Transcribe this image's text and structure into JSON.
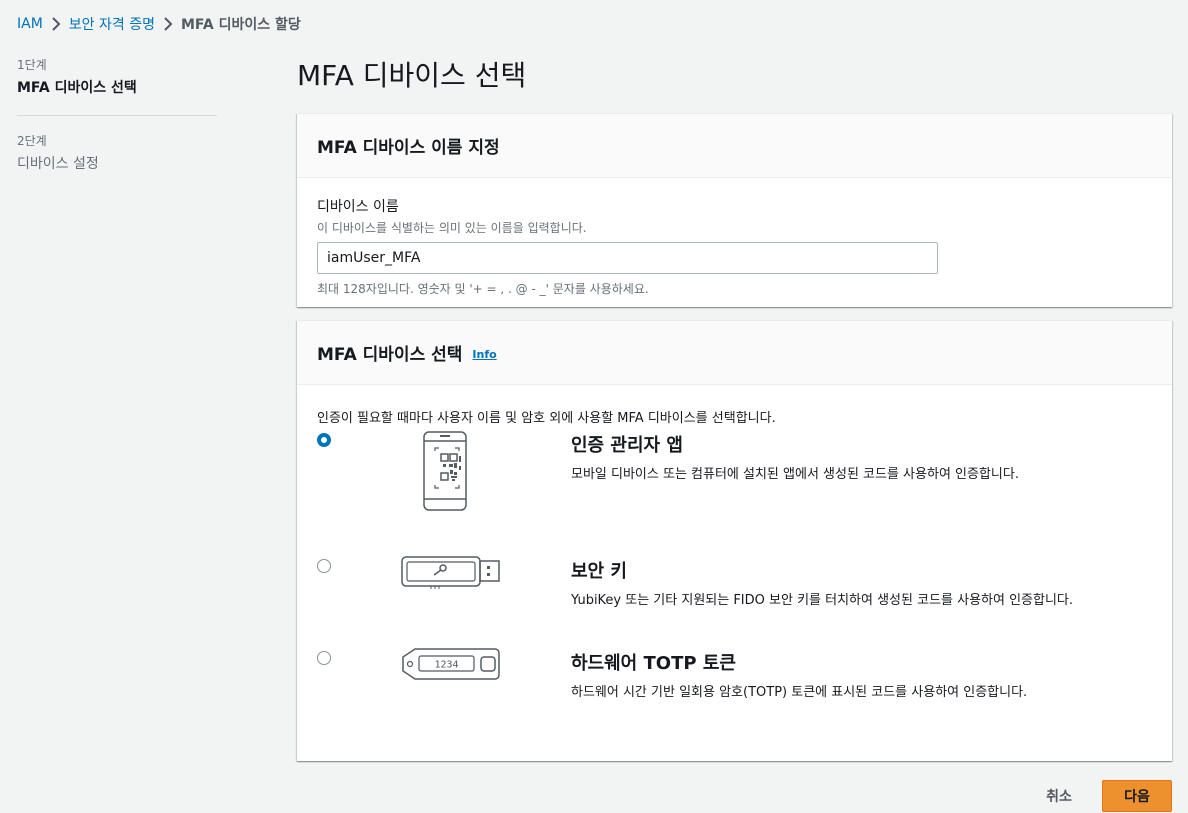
{
  "breadcrumb": {
    "items": [
      "IAM",
      "보안 자격 증명"
    ],
    "current": "MFA 디바이스 할당"
  },
  "steps": [
    {
      "number": "1단계",
      "title": "MFA 디바이스 선택",
      "active": true
    },
    {
      "number": "2단계",
      "title": "디바이스 설정",
      "active": false
    }
  ],
  "page_title": "MFA 디바이스 선택",
  "name_panel": {
    "heading": "MFA 디바이스 이름 지정",
    "label": "디바이스 이름",
    "description": "이 디바이스를 식별하는 의미 있는 이름을 입력합니다.",
    "value": "iamUser_MFA",
    "constraint": "최대 128자입니다. 영숫자 및 '+ = , . @ - _' 문자를 사용하세요."
  },
  "device_panel": {
    "heading": "MFA 디바이스 선택",
    "info_label": "Info",
    "intro": "인증이 필요할 때마다 사용자 이름 및 암호 외에 사용할 MFA 디바이스를 선택합니다.",
    "options": [
      {
        "title": "인증 관리자 앱",
        "description": "모바일 디바이스 또는 컴퓨터에 설치된 앱에서 생성된 코드를 사용하여 인증합니다.",
        "selected": true,
        "icon": "phone-qr-icon"
      },
      {
        "title": "보안 키",
        "description": "YubiKey 또는 기타 지원되는 FIDO 보안 키를 터치하여 생성된 코드를 사용하여 인증합니다.",
        "selected": false,
        "icon": "usb-security-key-icon"
      },
      {
        "title": "하드웨어 TOTP 토큰",
        "description": "하드웨어 시간 기반 일회용 암호(TOTP) 토큰에 표시된 코드를 사용하여 인증합니다.",
        "selected": false,
        "icon": "totp-token-icon",
        "token_digits": "1234"
      }
    ]
  },
  "footer": {
    "cancel_label": "취소",
    "next_label": "다음"
  },
  "colors": {
    "link": "#0073bb",
    "primary_button": "#ec912d",
    "background": "#f2f3f3"
  }
}
